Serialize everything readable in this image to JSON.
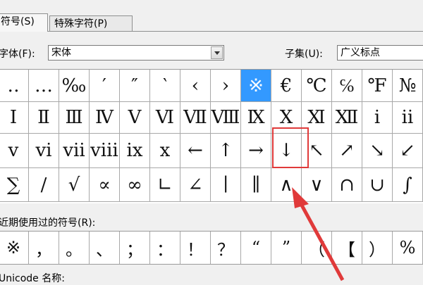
{
  "tabs": [
    {
      "label": "符号(S)",
      "active": true
    },
    {
      "label": "特殊字符(P)",
      "active": false
    }
  ],
  "font": {
    "label": "字体(F):",
    "value": "宋体"
  },
  "subset": {
    "label": "子集(U):",
    "value": "广义标点"
  },
  "grid_rows": [
    [
      "‥",
      "…",
      "‰",
      "′",
      "″",
      "‵",
      "‹",
      "›",
      "※",
      "€",
      "℃",
      "℅",
      "℉",
      "№"
    ],
    [
      "Ⅰ",
      "Ⅱ",
      "Ⅲ",
      "Ⅳ",
      "Ⅴ",
      "Ⅵ",
      "Ⅶ",
      "Ⅷ",
      "Ⅸ",
      "Ⅹ",
      "Ⅺ",
      "Ⅻ",
      "ⅰ",
      "ⅱ"
    ],
    [
      "ⅴ",
      "ⅵ",
      "ⅶ",
      "ⅷ",
      "ⅸ",
      "ⅹ",
      "←",
      "↑",
      "→",
      "↓",
      "↖",
      "↗",
      "↘",
      "↙"
    ],
    [
      "∑",
      "∕",
      "√",
      "∝",
      "∞",
      "∟",
      "∠",
      "∣",
      "∥",
      "∧",
      "∨",
      "∩",
      "∪",
      "∫"
    ]
  ],
  "selected_symbol": "※",
  "recent_label": "近期使用过的符号(R):",
  "recent_symbols": [
    "※",
    "，",
    "。",
    "、",
    "；",
    "：",
    "！",
    "？",
    "“",
    "”",
    "（",
    "【",
    "）",
    "%"
  ],
  "bottom_label": "Unicode 名称:",
  "colors": {
    "selection": "#3399ff",
    "annotation": "#e03a3a"
  }
}
